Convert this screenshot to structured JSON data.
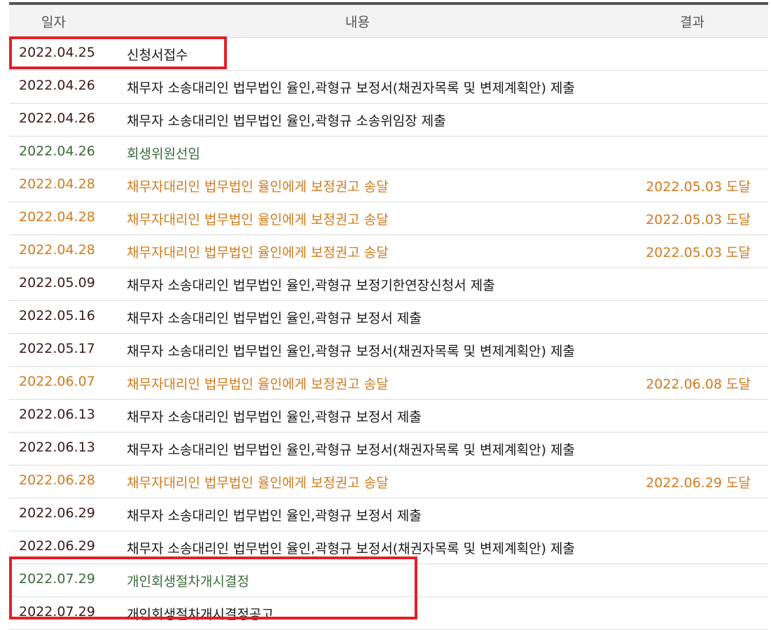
{
  "table": {
    "headers": {
      "date": "일자",
      "content": "내용",
      "result": "결과"
    },
    "rows": [
      {
        "date": "2022.04.25",
        "content": "신청서접수",
        "result": "",
        "tone": "normal"
      },
      {
        "date": "2022.04.26",
        "content": "채무자 소송대리인 법무법인 율인,곽형규 보정서(채권자목록 및 변제계획안) 제출",
        "result": "",
        "tone": "normal"
      },
      {
        "date": "2022.04.26",
        "content": "채무자 소송대리인 법무법인 율인,곽형규 소송위임장 제출",
        "result": "",
        "tone": "normal"
      },
      {
        "date": "2022.04.26",
        "content": "회생위원선임",
        "result": "",
        "tone": "green"
      },
      {
        "date": "2022.04.28",
        "content": "채무자대리인 법무법인 율인에게 보정권고 송달",
        "result": "2022.05.03 도달",
        "tone": "orange"
      },
      {
        "date": "2022.04.28",
        "content": "채무자대리인 법무법인 율인에게 보정권고 송달",
        "result": "2022.05.03 도달",
        "tone": "orange"
      },
      {
        "date": "2022.04.28",
        "content": "채무자대리인 법무법인 율인에게 보정권고 송달",
        "result": "2022.05.03 도달",
        "tone": "orange"
      },
      {
        "date": "2022.05.09",
        "content": "채무자 소송대리인 법무법인 율인,곽형규 보정기한연장신청서 제출",
        "result": "",
        "tone": "normal"
      },
      {
        "date": "2022.05.16",
        "content": "채무자 소송대리인 법무법인 율인,곽형규 보정서 제출",
        "result": "",
        "tone": "normal"
      },
      {
        "date": "2022.05.17",
        "content": "채무자 소송대리인 법무법인 율인,곽형규 보정서(채권자목록 및 변제계획안) 제출",
        "result": "",
        "tone": "normal"
      },
      {
        "date": "2022.06.07",
        "content": "채무자대리인 법무법인 율인에게 보정권고 송달",
        "result": "2022.06.08 도달",
        "tone": "orange"
      },
      {
        "date": "2022.06.13",
        "content": "채무자 소송대리인 법무법인 율인,곽형규 보정서 제출",
        "result": "",
        "tone": "normal"
      },
      {
        "date": "2022.06.13",
        "content": "채무자 소송대리인 법무법인 율인,곽형규 보정서(채권자목록 및 변제계획안) 제출",
        "result": "",
        "tone": "normal"
      },
      {
        "date": "2022.06.28",
        "content": "채무자대리인 법무법인 율인에게 보정권고 송달",
        "result": "2022.06.29 도달",
        "tone": "orange"
      },
      {
        "date": "2022.06.29",
        "content": "채무자 소송대리인 법무법인 율인,곽형규 보정서 제출",
        "result": "",
        "tone": "normal"
      },
      {
        "date": "2022.06.29",
        "content": "채무자 소송대리인 법무법인 율인,곽형규 보정서(채권자목록 및 변제계획안) 제출",
        "result": "",
        "tone": "normal"
      },
      {
        "date": "2022.07.29",
        "content": "개인회생절차개시결정",
        "result": "",
        "tone": "green"
      },
      {
        "date": "2022.07.29",
        "content": "개인회생절차개시결정공고",
        "result": "",
        "tone": "normal"
      }
    ]
  },
  "colors": {
    "normal_date": "#3c1a1a",
    "normal_text": "#1a1a1a",
    "green": "#3a6a3a",
    "orange": "#d17a1c",
    "highlight": "#e0202a"
  }
}
